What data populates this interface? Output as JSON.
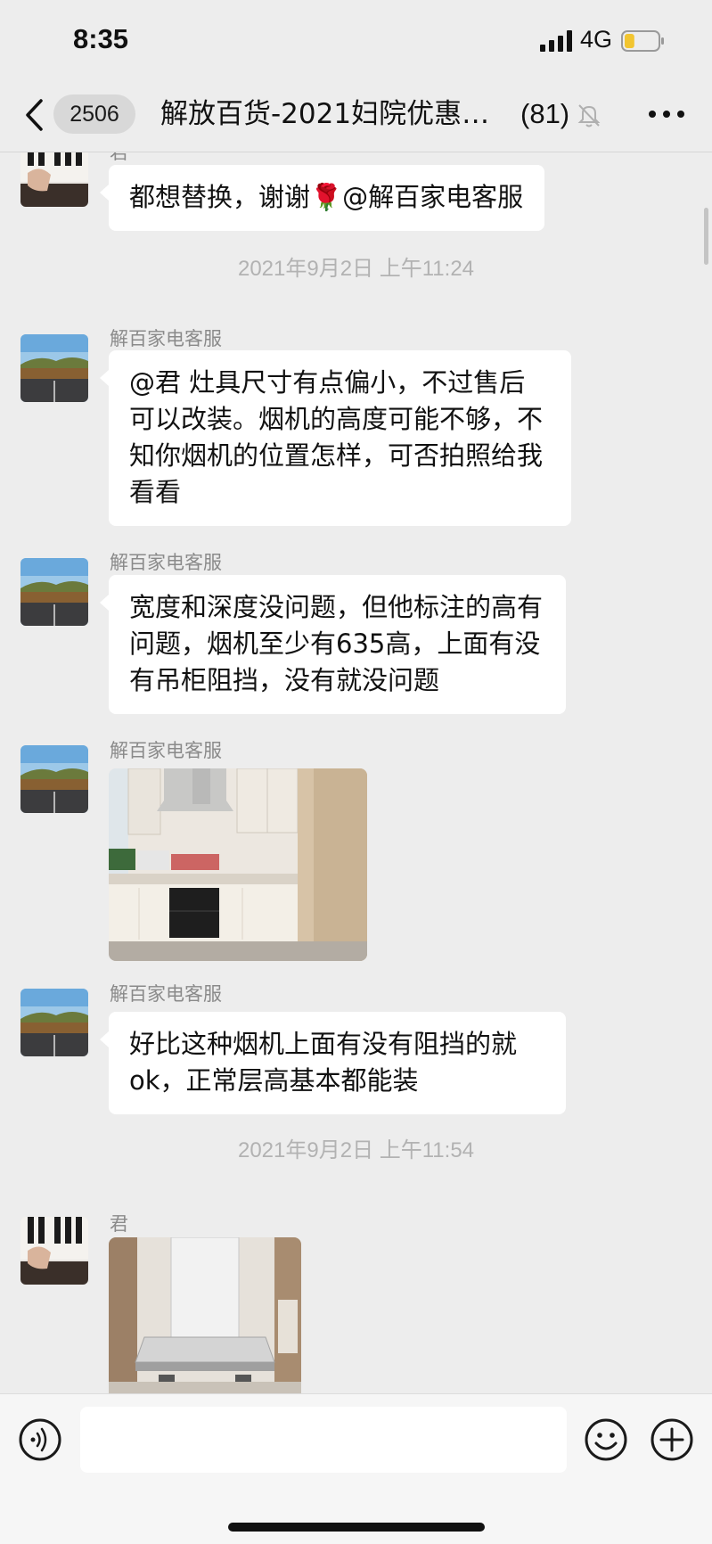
{
  "status_bar": {
    "time": "8:35",
    "network": "4G",
    "battery_level": 0.3
  },
  "nav": {
    "unread_count": "2506",
    "title": "解放百货-2021妇院优惠…",
    "member_count": "(81)",
    "icons": [
      "chevron-left-icon",
      "mute-bell-icon",
      "more-icon"
    ]
  },
  "messages": [
    {
      "type": "text",
      "sender": "君",
      "text": "都想替换，谢谢🌹@解百家电客服"
    },
    {
      "type": "time",
      "text": "2021年9月2日 上午11:24"
    },
    {
      "type": "text",
      "sender": "解百家电客服",
      "text": "@君 灶具尺寸有点偏小，不过售后可以改装。烟机的高度可能不够，不知你烟机的位置怎样，可否拍照给我看看"
    },
    {
      "type": "text",
      "sender": "解百家电客服",
      "text": "宽度和深度没问题，但他标注的高有问题，烟机至少有635高，上面有没有吊柜阻挡，没有就没问题"
    },
    {
      "type": "image",
      "sender": "解百家电客服",
      "description_icon": "kitchen-photo"
    },
    {
      "type": "text",
      "sender": "解百家电客服",
      "text": "好比这种烟机上面有没有阻挡的就ok，正常层高基本都能装"
    },
    {
      "type": "time",
      "text": "2021年9月2日 上午11:54"
    },
    {
      "type": "image",
      "sender": "君",
      "description_icon": "range-hood-photo"
    }
  ],
  "input_bar": {
    "placeholder": "",
    "icons": [
      "voice-icon",
      "emoji-icon",
      "plus-icon"
    ]
  },
  "colors": {
    "background": "#ededed",
    "bubble": "#ffffff",
    "timestamp": "#b2b2b2",
    "sender": "#8a8a8a"
  }
}
